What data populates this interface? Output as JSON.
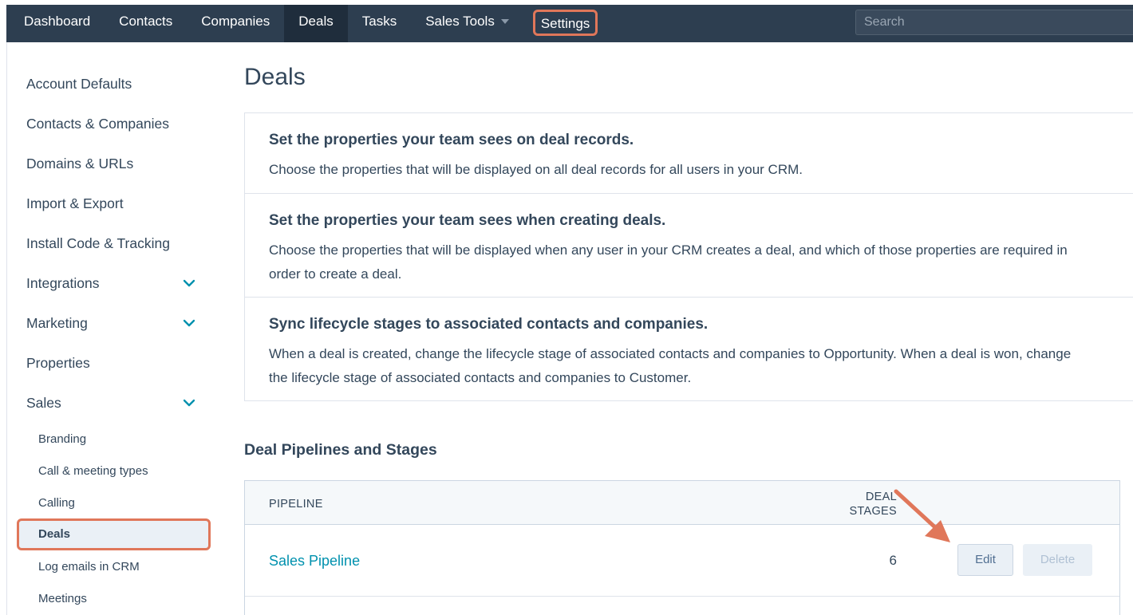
{
  "topnav": {
    "items": [
      "Dashboard",
      "Contacts",
      "Companies",
      "Deals",
      "Tasks",
      "Sales Tools"
    ],
    "active": "Deals",
    "settings_label": "Settings",
    "search_placeholder": "Search"
  },
  "sidebar": {
    "items": [
      {
        "label": "Account Defaults"
      },
      {
        "label": "Contacts & Companies"
      },
      {
        "label": "Domains & URLs"
      },
      {
        "label": "Import & Export"
      },
      {
        "label": "Install Code & Tracking"
      },
      {
        "label": "Integrations",
        "icon": "chevron-down-icon"
      },
      {
        "label": "Marketing",
        "icon": "chevron-down-icon"
      },
      {
        "label": "Properties"
      },
      {
        "label": "Sales",
        "icon": "chevron-down-icon"
      }
    ],
    "sales_subitems": [
      "Branding",
      "Call & meeting types",
      "Calling",
      "Deals",
      "Log emails in CRM",
      "Meetings"
    ],
    "active_subitem": "Deals"
  },
  "main": {
    "title": "Deals",
    "cards": [
      {
        "heading": "Set the properties your team sees on deal records.",
        "description": "Choose the properties that will be displayed on all deal records for all users in your CRM."
      },
      {
        "heading": "Set the properties your team sees when creating deals.",
        "description": "Choose the properties that will be displayed when any user in your CRM creates a deal, and which of those properties are required in order to create a deal."
      },
      {
        "heading": "Sync lifecycle stages to associated contacts and companies.",
        "description": "When a deal is created, change the lifecycle stage of associated contacts and companies to Opportunity. When a deal is won, change the lifecycle stage of associated contacts and companies to Customer."
      }
    ],
    "pipelines_section": {
      "title": "Deal Pipelines and Stages",
      "columns": {
        "pipeline": "PIPELINE",
        "stages_line1": "DEAL",
        "stages_line2": "STAGES"
      },
      "rows": [
        {
          "name": "Sales Pipeline",
          "stages": "6",
          "edit_label": "Edit",
          "delete_label": "Delete"
        }
      ]
    }
  },
  "colors": {
    "nav_bg": "#2d3e50",
    "highlight": "#e0775a",
    "link": "#0091ae",
    "text": "#33475b",
    "chevron": "#0091ae"
  }
}
